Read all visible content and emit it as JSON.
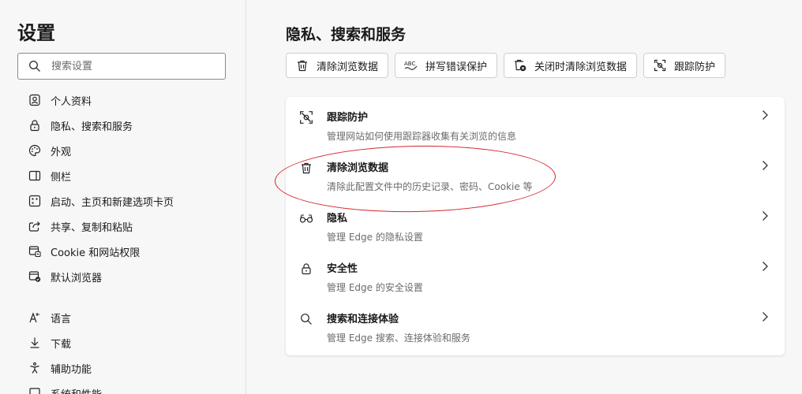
{
  "sidebar": {
    "title": "设置",
    "search_placeholder": "搜索设置",
    "items": [
      {
        "label": "个人资料",
        "icon": "profile-icon"
      },
      {
        "label": "隐私、搜索和服务",
        "icon": "lock-icon"
      },
      {
        "label": "外观",
        "icon": "palette-icon"
      },
      {
        "label": "侧栏",
        "icon": "sidebar-icon"
      },
      {
        "label": "启动、主页和新建选项卡页",
        "icon": "home-grid-icon"
      },
      {
        "label": "共享、复制和粘贴",
        "icon": "share-icon"
      },
      {
        "label": "Cookie 和网站权限",
        "icon": "cookie-permissions-icon"
      },
      {
        "label": "默认浏览器",
        "icon": "default-browser-icon"
      }
    ],
    "items2": [
      {
        "label": "语言",
        "icon": "language-icon"
      },
      {
        "label": "下载",
        "icon": "download-icon"
      },
      {
        "label": "辅助功能",
        "icon": "accessibility-icon"
      },
      {
        "label": "系统和性能",
        "icon": "system-icon"
      }
    ]
  },
  "main": {
    "title": "隐私、搜索和服务",
    "buttons": [
      {
        "label": "清除浏览数据",
        "icon": "trash-icon"
      },
      {
        "label": "拼写错误保护",
        "icon": "spellcheck-icon"
      },
      {
        "label": "关闭时清除浏览数据",
        "icon": "trash-clock-icon"
      },
      {
        "label": "跟踪防护",
        "icon": "tracking-icon"
      }
    ],
    "rows": [
      {
        "title": "跟踪防护",
        "subtitle": "管理网站如何使用跟踪器收集有关浏览的信息",
        "icon": "tracking-icon"
      },
      {
        "title": "清除浏览数据",
        "subtitle": "清除此配置文件中的历史记录、密码、Cookie 等",
        "icon": "trash-icon"
      },
      {
        "title": "隐私",
        "subtitle": "管理 Edge 的隐私设置",
        "icon": "glasses-icon"
      },
      {
        "title": "安全性",
        "subtitle": "管理 Edge 的安全设置",
        "icon": "lock-icon"
      },
      {
        "title": "搜索和连接体验",
        "subtitle": "管理 Edge 搜索、连接体验和服务",
        "icon": "search-icon"
      }
    ]
  },
  "colors": {
    "annotation": "#d4262b",
    "background": "#f7f7f7",
    "card": "#ffffff"
  }
}
